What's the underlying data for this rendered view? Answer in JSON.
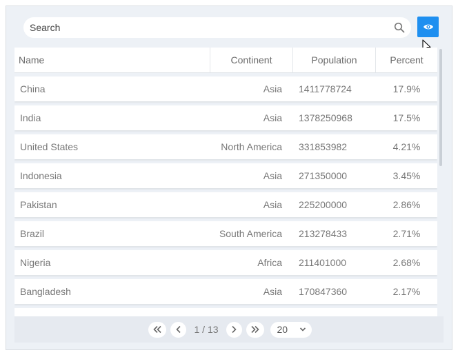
{
  "search": {
    "placeholder": "Search",
    "value": ""
  },
  "toolbar": {
    "visibility_icon": "eye-icon",
    "accent": "#1e8ff0"
  },
  "table": {
    "columns": [
      "Name",
      "Continent",
      "Population",
      "Percent"
    ],
    "rows": [
      {
        "name": "China",
        "continent": "Asia",
        "population": "1411778724",
        "percent": "17.9%"
      },
      {
        "name": "India",
        "continent": "Asia",
        "population": "1378250968",
        "percent": "17.5%"
      },
      {
        "name": "United States",
        "continent": "North America",
        "population": "331853982",
        "percent": "4.21%"
      },
      {
        "name": "Indonesia",
        "continent": "Asia",
        "population": "271350000",
        "percent": "3.45%"
      },
      {
        "name": "Pakistan",
        "continent": "Asia",
        "population": "225200000",
        "percent": "2.86%"
      },
      {
        "name": "Brazil",
        "continent": "South America",
        "population": "213278433",
        "percent": "2.71%"
      },
      {
        "name": "Nigeria",
        "continent": "Africa",
        "population": "211401000",
        "percent": "2.68%"
      },
      {
        "name": "Bangladesh",
        "continent": "Asia",
        "population": "170847360",
        "percent": "2.17%"
      }
    ]
  },
  "pager": {
    "page_info": "1 / 13",
    "page_size": "20",
    "icons": [
      "double-chevron-left-icon",
      "chevron-left-icon",
      "chevron-right-icon",
      "double-chevron-right-icon",
      "chevron-down-icon"
    ]
  }
}
